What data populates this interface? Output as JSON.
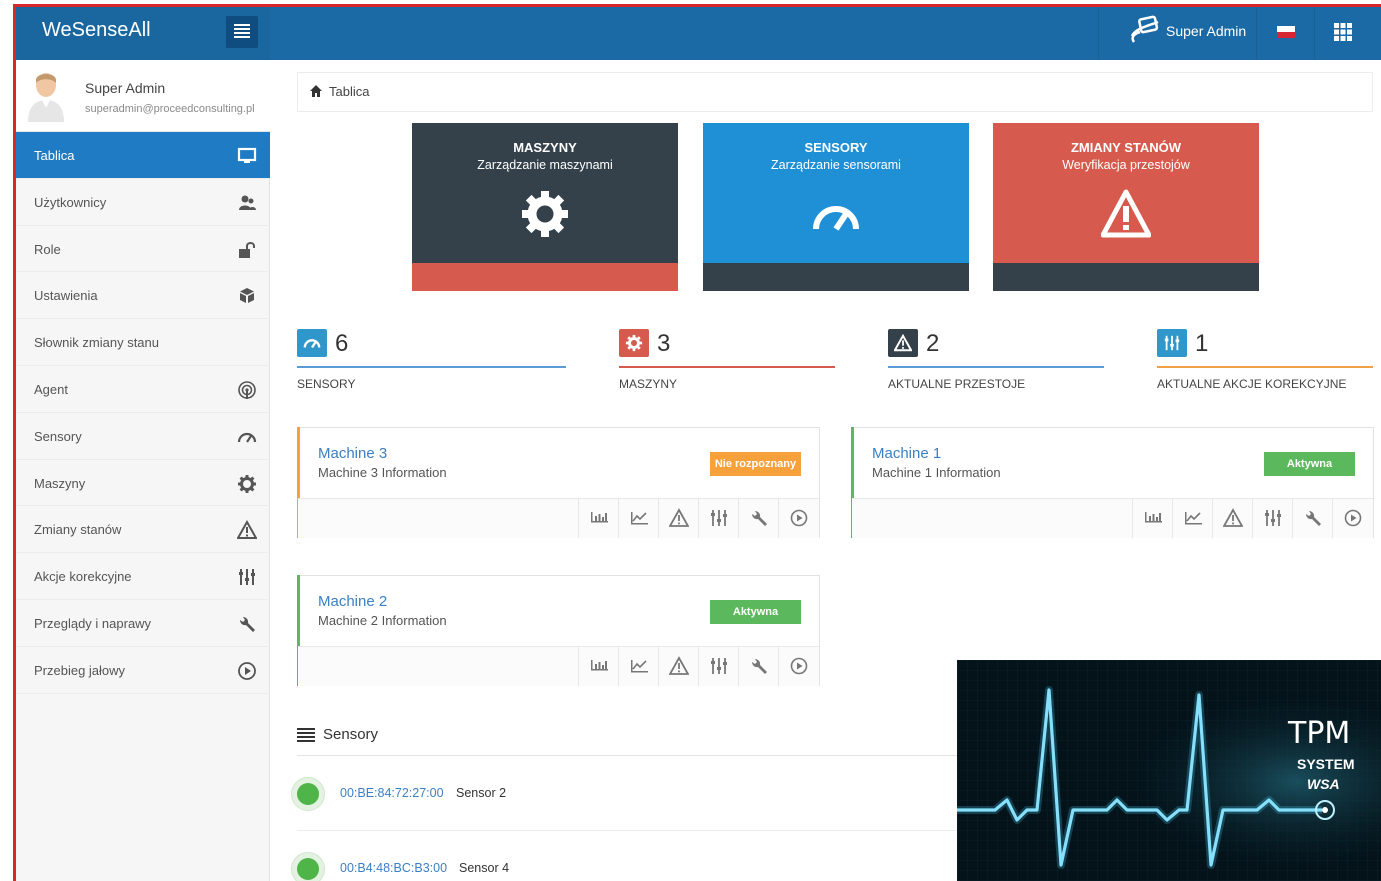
{
  "header": {
    "brand": "WeSenseAll",
    "user": "Super Admin"
  },
  "profile": {
    "name": "Super Admin",
    "email": "superadmin@proceedconsulting.pl"
  },
  "sidebar": {
    "items": [
      {
        "label": "Tablica",
        "icon": "monitor-icon",
        "active": true
      },
      {
        "label": "Użytkownicy",
        "icon": "users-icon"
      },
      {
        "label": "Role",
        "icon": "unlock-icon"
      },
      {
        "label": "Ustawienia",
        "icon": "cubes-icon"
      },
      {
        "label": "Słownik zmiany stanu",
        "icon": ""
      },
      {
        "label": "Agent",
        "icon": "signal-icon"
      },
      {
        "label": "Sensory",
        "icon": "gauge-icon"
      },
      {
        "label": "Maszyny",
        "icon": "gear-icon"
      },
      {
        "label": "Zmiany stanów",
        "icon": "warning-icon"
      },
      {
        "label": "Akcje korekcyjne",
        "icon": "sliders-icon"
      },
      {
        "label": "Przeglądy i naprawy",
        "icon": "wrench-icon"
      },
      {
        "label": "Przebieg jałowy",
        "icon": "play-circle-icon"
      }
    ]
  },
  "breadcrumb": {
    "label": "Tablica"
  },
  "tiles": [
    {
      "title": "MASZYNY",
      "subtitle": "Zarządzanie maszynami",
      "color": "#34414b",
      "foot": "#d65b4e"
    },
    {
      "title": "SENSORY",
      "subtitle": "Zarządzanie sensorami",
      "color": "#1f8fd6",
      "foot": "#34414b"
    },
    {
      "title": "ZMIANY STANÓW",
      "subtitle": "Weryfikacja przestojów",
      "color": "#d65b4e",
      "foot": "#34414b"
    }
  ],
  "stats": [
    {
      "value": "6",
      "label": "SENSORY",
      "color": "#2f97c9",
      "line": "#5b9bd5"
    },
    {
      "value": "3",
      "label": "MASZYNY",
      "color": "#d65b4e",
      "line": "#d65b4e"
    },
    {
      "value": "2",
      "label": "AKTUALNE PRZESTOJE",
      "color": "#34414b",
      "line": "#5b9bd5"
    },
    {
      "value": "1",
      "label": "AKTUALNE AKCJE KOREKCYJNE",
      "color": "#2f97c9",
      "line": "#f0a04b"
    }
  ],
  "machines": [
    {
      "name": "Machine 3",
      "info": "Machine 3 Information",
      "status": "Nie rozpoznany",
      "status_color": "#f7a13c",
      "accent": "#f7a13c"
    },
    {
      "name": "Machine 1",
      "info": "Machine 1 Information",
      "status": "Aktywna",
      "status_color": "#5cb85c",
      "accent": "#5cb85c"
    },
    {
      "name": "Machine 2",
      "info": "Machine 2 Information",
      "status": "Aktywna",
      "status_color": "#5cb85c",
      "accent": "#5cb85c"
    }
  ],
  "sensors": {
    "title": "Sensory",
    "rows": [
      {
        "mac": "00:BE:84:72:27:00",
        "name": "Sensor 2"
      },
      {
        "mac": "00:B4:48:BC:B3:00",
        "name": "Sensor 4"
      }
    ]
  },
  "tpm": {
    "title": "TPM",
    "line1": "SYSTEM",
    "line2": "WSA"
  }
}
